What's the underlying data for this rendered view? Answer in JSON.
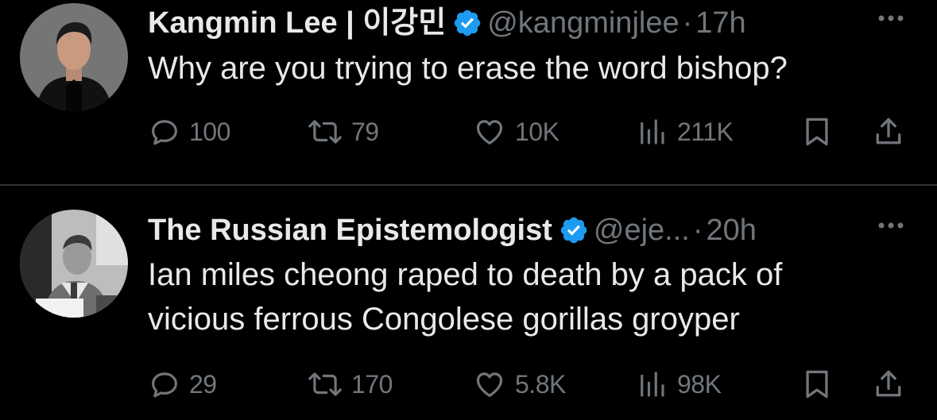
{
  "tweets": [
    {
      "display_name": "Kangmin Lee | 이강민",
      "verified": true,
      "handle": "@kangminjlee",
      "separator": "·",
      "time": "17h",
      "text": "Why are you trying to erase the word bishop?",
      "replies": "100",
      "reposts": "79",
      "likes": "10K",
      "views": "211K"
    },
    {
      "display_name": "The Russian Epistemologist",
      "verified": true,
      "handle": "@eje...",
      "separator": "·",
      "time": "20h",
      "text": "Ian miles cheong raped to death by a pack of\nvicious ferrous Congolese gorillas groyper",
      "replies": "29",
      "reposts": "170",
      "likes": "5.8K",
      "views": "98K"
    }
  ],
  "icons": {
    "reply": "reply-icon",
    "repost": "repost-icon",
    "like": "heart-icon",
    "views": "views-bar-chart-icon",
    "bookmark": "bookmark-icon",
    "share": "share-icon",
    "more": "more-dots-icon",
    "verified": "verified-badge-icon"
  },
  "colors": {
    "background": "#000000",
    "text_primary": "#e7e9ea",
    "text_secondary": "#71767b",
    "verified_blue": "#1d9bf0",
    "divider": "#2f3336"
  }
}
